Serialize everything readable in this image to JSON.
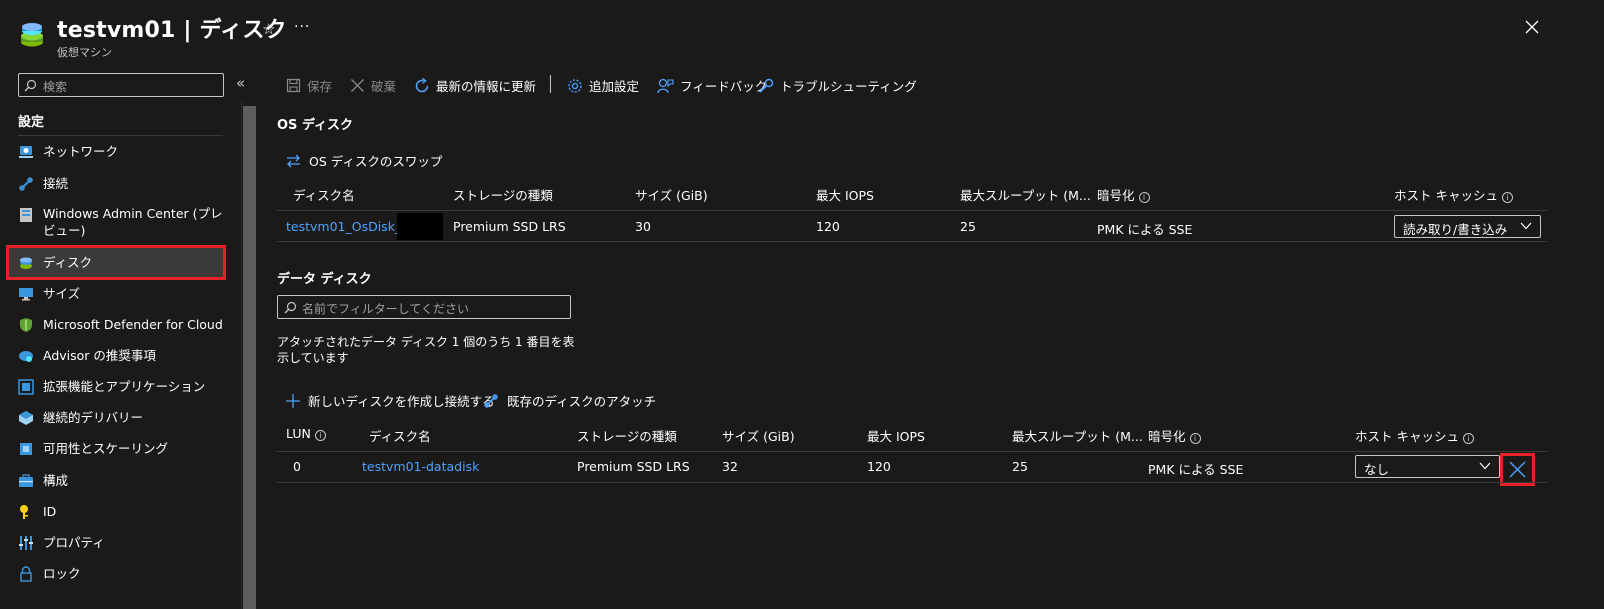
{
  "header": {
    "title": "testvm01 | ディスク",
    "subtitle": "仮想マシン",
    "star_label": "☆",
    "more_label": "···"
  },
  "sidebar": {
    "search_placeholder": "検索",
    "collapse_label": "«",
    "section_title": "設定",
    "items": [
      {
        "label": "ネットワーク",
        "icon": "network-icon"
      },
      {
        "label": "接続",
        "icon": "connect-icon"
      },
      {
        "label": "Windows Admin Center (プレビュー)",
        "icon": "admin-center-icon"
      },
      {
        "label": "ディスク",
        "icon": "disk-icon",
        "selected": true
      },
      {
        "label": "サイズ",
        "icon": "size-icon"
      },
      {
        "label": "Microsoft Defender for Cloud",
        "icon": "defender-icon"
      },
      {
        "label": "Advisor の推奨事項",
        "icon": "advisor-icon"
      },
      {
        "label": "拡張機能とアプリケーション",
        "icon": "extensions-icon"
      },
      {
        "label": "継続的デリバリー",
        "icon": "delivery-icon"
      },
      {
        "label": "可用性とスケーリング",
        "icon": "availability-icon"
      },
      {
        "label": "構成",
        "icon": "configuration-icon"
      },
      {
        "label": "ID",
        "icon": "identity-icon"
      },
      {
        "label": "プロパティ",
        "icon": "properties-icon"
      },
      {
        "label": "ロック",
        "icon": "lock-icon"
      }
    ]
  },
  "toolbar": {
    "save": "保存",
    "discard": "破棄",
    "refresh": "最新の情報に更新",
    "additional_settings": "追加設定",
    "feedback": "フィードバック",
    "troubleshoot": "トラブルシューティング"
  },
  "os_disk": {
    "heading": "OS ディスク",
    "swap_action": "OS ディスクのスワップ",
    "columns": [
      "ディスク名",
      "ストレージの種類",
      "サイズ (GiB)",
      "最大 IOPS",
      "最大スループット (M...",
      "暗号化",
      "ホスト キャッシュ"
    ],
    "row": {
      "name": "testvm01_OsDisk_1_",
      "storage": "Premium SSD LRS",
      "size": "30",
      "iops": "120",
      "throughput": "25",
      "encryption": "PMK による SSE",
      "cache": "読み取り/書き込み"
    }
  },
  "data_disks": {
    "heading": "データ ディスク",
    "filter_placeholder": "名前でフィルターしてください",
    "count_text": "アタッチされたデータ ディスク 1 個のうち 1 番目を表示しています",
    "create_action": "新しいディスクを作成し接続する",
    "attach_action": "既存のディスクのアタッチ",
    "columns": [
      "LUN",
      "ディスク名",
      "ストレージの種類",
      "サイズ (GiB)",
      "最大 IOPS",
      "最大スループット (M...",
      "暗号化",
      "ホスト キャッシュ"
    ],
    "rows": [
      {
        "lun": "0",
        "name": "testvm01-datadisk",
        "storage": "Premium SSD LRS",
        "size": "32",
        "iops": "120",
        "throughput": "25",
        "encryption": "PMK による SSE",
        "cache": "なし"
      }
    ]
  },
  "info_glyph": "i",
  "colors": {
    "background": "#1b1a19",
    "link": "#4da3ff",
    "highlight": "#e8202a",
    "accent_icon": "#3a96dd"
  }
}
